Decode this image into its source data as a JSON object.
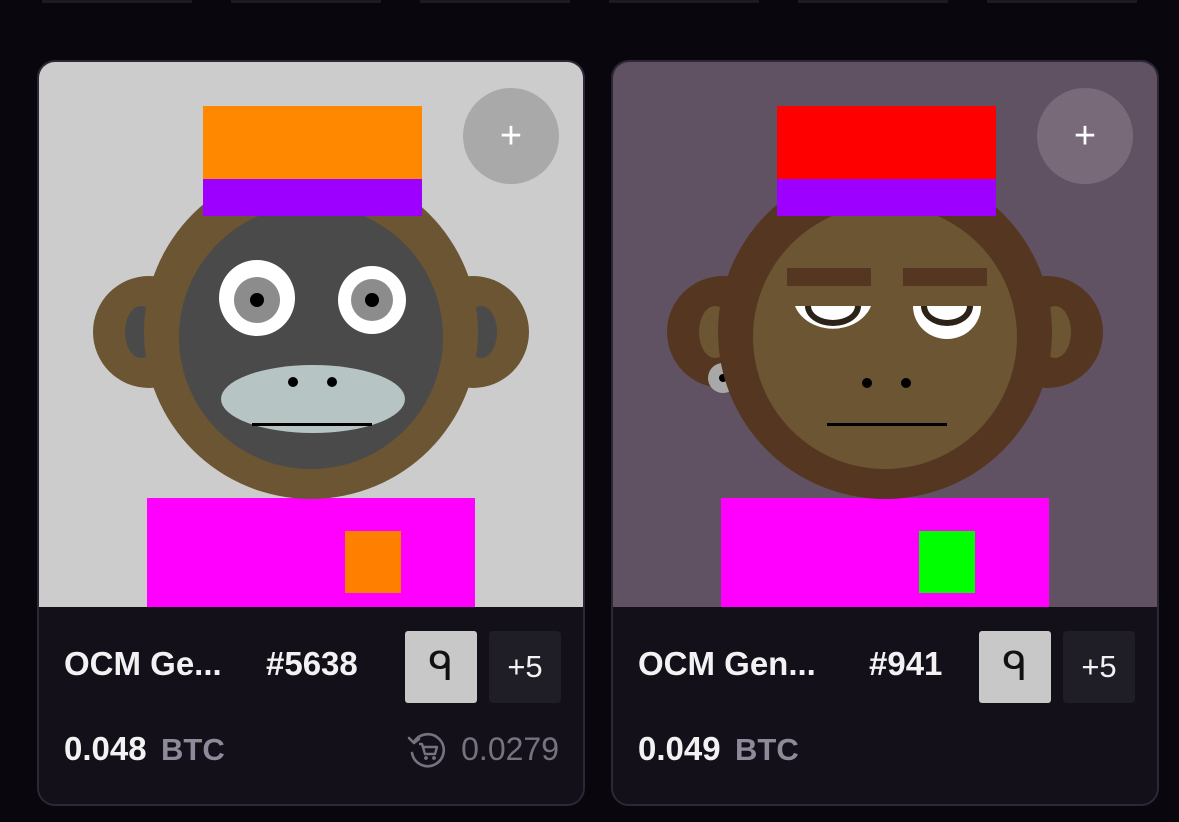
{
  "cards": [
    {
      "name": "OCM Ge...",
      "number": "#5638",
      "rune": "ᑫ",
      "more": "+5",
      "add_icon": "+",
      "price": "0.048",
      "unit": "BTC",
      "last_sale": "0.0279",
      "art": {
        "background": "#cccccc",
        "hat_top": "#ff8800",
        "hat_band": "#9d00ff",
        "head": "#6b5532",
        "face": "#4a4a4a",
        "muzzle": "#b6c4c4",
        "body": "#ff00ff",
        "pocket": "#ff8000"
      }
    },
    {
      "name": "OCM Gen...",
      "number": "#941",
      "rune": "ᑫ",
      "more": "+5",
      "add_icon": "+",
      "price": "0.049",
      "unit": "BTC",
      "art": {
        "background": "#605262",
        "hat_top": "#ff0000",
        "hat_band": "#9d00ff",
        "head": "#553620",
        "face": "#6b5532",
        "body": "#ff00ff",
        "pocket": "#00ff00"
      }
    }
  ]
}
